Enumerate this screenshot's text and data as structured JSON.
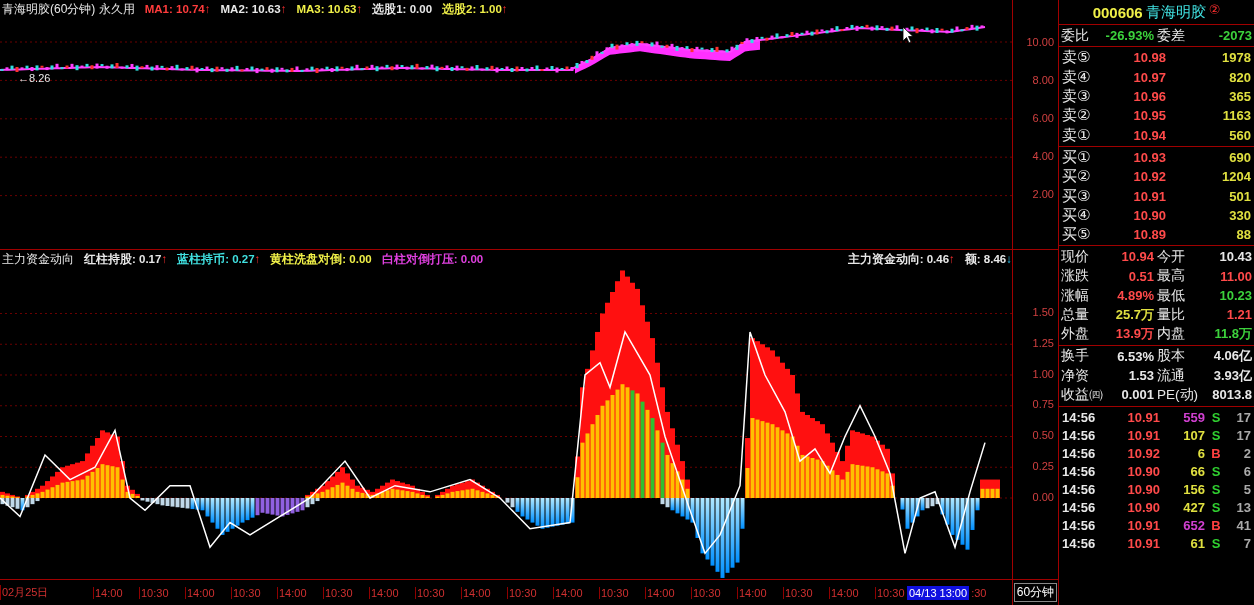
{
  "chart_legend": {
    "title": "青海明胶(60分钟) 永久用",
    "items": [
      {
        "label": "MA1: 10.74",
        "arrow": "↑",
        "falling": false,
        "color": "#ff3c3c"
      },
      {
        "label": "MA2: 10.63",
        "arrow": "↑",
        "falling": false,
        "color": "#e8e8e8"
      },
      {
        "label": "MA3: 10.63",
        "arrow": "↑",
        "falling": false,
        "color": "#f0f048"
      },
      {
        "label": "选股1: 0.00",
        "color": "#e8e8e8"
      },
      {
        "label": "选股2: 1.00",
        "arrow": "↑",
        "falling": false,
        "color": "#f0f048"
      }
    ]
  },
  "price_chart": {
    "last_marker": "←8.26",
    "axis_labels": [
      "10.00",
      "8.00",
      "6.00",
      "4.00",
      "2.00"
    ]
  },
  "indicator_legend": {
    "title": "主力资金动向",
    "items": [
      {
        "label": "红柱持股: 0.17",
        "arrow": "↑",
        "falling": false,
        "color": "#e8e8e8"
      },
      {
        "label": "蓝柱持币: 0.27",
        "arrow": "↑",
        "falling": false,
        "color": "#40e0e0"
      },
      {
        "label": "黄柱洗盘对倒: 0.00",
        "color": "#f0f048"
      },
      {
        "label": "白柱对倒打压: 0.00",
        "color": "#e040e0"
      }
    ],
    "right_items": [
      {
        "label": "主力资金动向: 0.46",
        "arrow": "↑",
        "falling": false,
        "color": "#e8e8e8"
      },
      {
        "label": "额: 8.46",
        "arrow": "↓",
        "falling": true,
        "color": "#e8e8e8"
      }
    ]
  },
  "indicator_chart": {
    "axis_labels": [
      "1.50",
      "1.25",
      "1.00",
      "0.75",
      "0.50",
      "0.25",
      "0.00"
    ]
  },
  "time_axis": {
    "labels": [
      "02月25日",
      "14:00",
      "10:30",
      "14:00",
      "10:30",
      "14:00",
      "10:30",
      "14:00",
      "10:30",
      "14:00",
      "10:30",
      "14:00",
      "10:30",
      "14:00",
      "10:30",
      "14:00",
      "10:30",
      "14:00",
      "10:30"
    ],
    "cursor_label": "04/13 13:00",
    "trailing_label": ":30",
    "period": "60分钟"
  },
  "quote": {
    "code": "000606",
    "name": "青海明胶",
    "badge": "②",
    "ratio": [
      {
        "label": "委比",
        "value": "-26.93%",
        "color": "#3cd23c"
      },
      {
        "label": "委差",
        "value": "-2073",
        "color": "#3cd23c"
      }
    ],
    "asks": [
      {
        "label": "卖⑤",
        "price": "10.98",
        "volume": "1978"
      },
      {
        "label": "卖④",
        "price": "10.97",
        "volume": "820"
      },
      {
        "label": "卖③",
        "price": "10.96",
        "volume": "365"
      },
      {
        "label": "卖②",
        "price": "10.95",
        "volume": "1163"
      },
      {
        "label": "卖①",
        "price": "10.94",
        "volume": "560"
      }
    ],
    "bids": [
      {
        "label": "买①",
        "price": "10.93",
        "volume": "690"
      },
      {
        "label": "买②",
        "price": "10.92",
        "volume": "1204"
      },
      {
        "label": "买③",
        "price": "10.91",
        "volume": "501"
      },
      {
        "label": "买④",
        "price": "10.90",
        "volume": "330"
      },
      {
        "label": "买⑤",
        "price": "10.89",
        "volume": "88"
      }
    ],
    "stats": [
      [
        {
          "label": "现价",
          "value": "10.94",
          "color": "#ff4a4a"
        },
        {
          "label": "今开",
          "value": "10.43",
          "color": "#e8e8e8"
        }
      ],
      [
        {
          "label": "涨跌",
          "value": "0.51",
          "color": "#ff4a4a"
        },
        {
          "label": "最高",
          "value": "11.00",
          "color": "#ff4a4a"
        }
      ],
      [
        {
          "label": "涨幅",
          "value": "4.89%",
          "color": "#ff4a4a"
        },
        {
          "label": "最低",
          "value": "10.23",
          "color": "#3cd23c"
        }
      ],
      [
        {
          "label": "总量",
          "value": "25.7万",
          "color": "#e0e040"
        },
        {
          "label": "量比",
          "value": "1.21",
          "color": "#ff4a4a"
        }
      ],
      [
        {
          "label": "外盘",
          "value": "13.9万",
          "color": "#ff4a4a"
        },
        {
          "label": "内盘",
          "value": "11.8万",
          "color": "#3cd23c"
        }
      ]
    ],
    "fundamentals": [
      [
        {
          "label": "换手",
          "value": "6.53%"
        },
        {
          "label": "股本",
          "value": "4.06亿"
        }
      ],
      [
        {
          "label": "净资",
          "value": "1.53"
        },
        {
          "label": "流通",
          "value": "3.93亿"
        }
      ],
      [
        {
          "label": "收益㈣",
          "value": "0.001"
        },
        {
          "label": "PE(动)",
          "value": "8013.8"
        }
      ]
    ],
    "trades": [
      {
        "time": "14:56",
        "price": "10.91",
        "volume": "559",
        "large": true,
        "side": "S",
        "buy": false,
        "count": "17"
      },
      {
        "time": "14:56",
        "price": "10.91",
        "volume": "107",
        "large": false,
        "side": "S",
        "buy": false,
        "count": "17"
      },
      {
        "time": "14:56",
        "price": "10.92",
        "volume": "6",
        "large": false,
        "side": "B",
        "buy": true,
        "count": "2"
      },
      {
        "time": "14:56",
        "price": "10.90",
        "volume": "66",
        "large": false,
        "side": "S",
        "buy": false,
        "count": "6"
      },
      {
        "time": "14:56",
        "price": "10.90",
        "volume": "156",
        "large": false,
        "side": "S",
        "buy": false,
        "count": "5"
      },
      {
        "time": "14:56",
        "price": "10.90",
        "volume": "427",
        "large": false,
        "side": "S",
        "buy": false,
        "count": "13"
      },
      {
        "time": "14:56",
        "price": "10.91",
        "volume": "652",
        "large": true,
        "side": "B",
        "buy": true,
        "count": "41"
      },
      {
        "time": "14:56",
        "price": "10.91",
        "volume": "61",
        "large": false,
        "side": "S",
        "buy": false,
        "count": "7"
      }
    ]
  }
}
